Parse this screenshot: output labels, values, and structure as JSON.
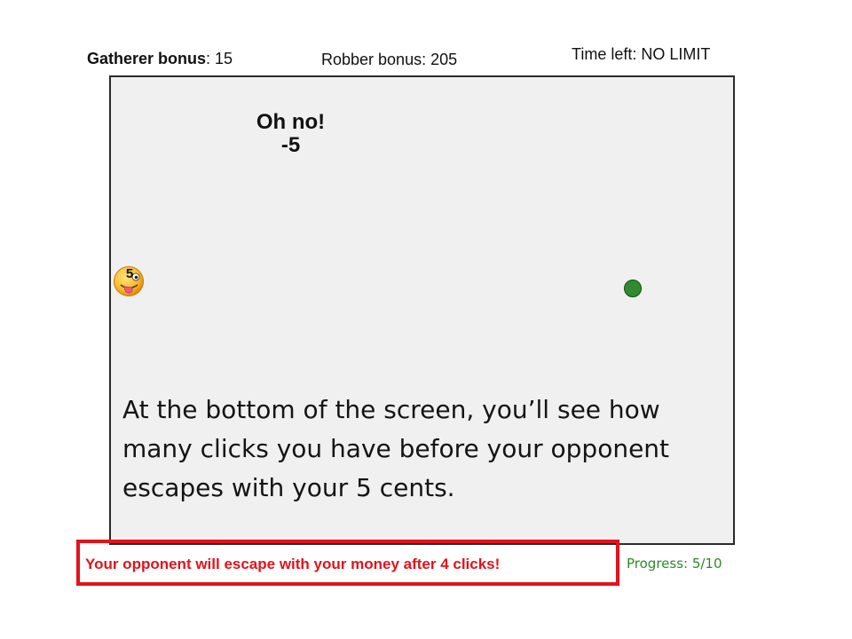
{
  "hud": {
    "gatherer_label": "Gatherer bonus",
    "gatherer_value": ": 15",
    "robber_text": "Robber bonus: 205",
    "time_left_text": "Time left: NO LIMIT"
  },
  "feedback": {
    "title": "Oh no!",
    "delta": "-5"
  },
  "player": {
    "icon": "silly-face-emoji",
    "badge": "5"
  },
  "coin": {
    "color": "#2e8b2e"
  },
  "instruction": "At the bottom of the screen, you’ll see how many clicks you have before your opponent escapes with your 5 cents.",
  "footer": {
    "escape_message": "Your opponent will  escape with  your money after 4 clicks!",
    "progress_text": "Progress: 5/10"
  },
  "colors": {
    "highlight": "#e3121b",
    "progress": "#2a8a2a",
    "arena_bg": "#f0f0f1"
  }
}
